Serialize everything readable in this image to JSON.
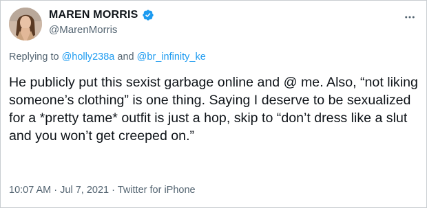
{
  "author": {
    "display_name": "MAREN MORRIS",
    "handle": "@MarenMorris",
    "verified": true,
    "avatar_icon": "profile-photo"
  },
  "reply_context": {
    "prefix": "Replying to",
    "mentions": [
      "@holly238a",
      "@br_infinity_ke"
    ],
    "conjunction": "and"
  },
  "tweet": {
    "text": "He publicly put this sexist garbage online and @ me. Also, “not liking someone’s clothing” is one thing. Saying I deserve to be sexualized for a *pretty tame* outfit is just a hop, skip to “don’t dress like a slut and you won’t get creeped on.”"
  },
  "meta": {
    "time": "10:07 AM",
    "date": "Jul 7, 2021",
    "separator": "·",
    "source": "Twitter for iPhone"
  },
  "colors": {
    "accent": "#1d9bf0",
    "secondary_text": "#536471",
    "primary_text": "#0f1419"
  },
  "icons": {
    "verified": "verified-badge-icon",
    "more": "more-options-icon"
  }
}
